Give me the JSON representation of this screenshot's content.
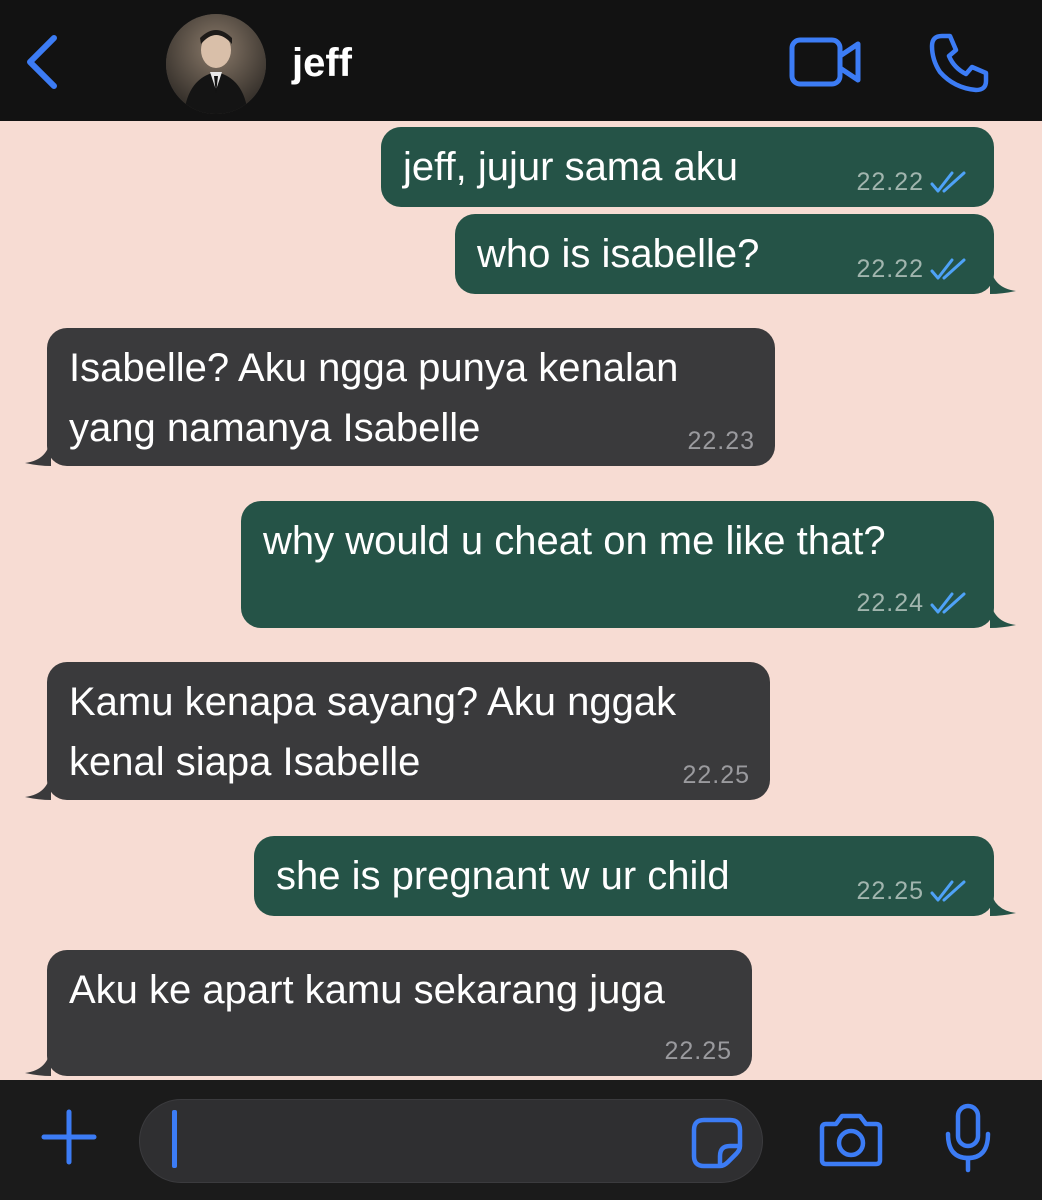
{
  "header": {
    "contact_name": "jeff",
    "icons": [
      "back-chevron-icon",
      "avatar",
      "video-call-icon",
      "phone-call-icon"
    ]
  },
  "messages": [
    {
      "direction": "out",
      "text": "jeff, jujur sama aku",
      "time": "22.22",
      "status": "read"
    },
    {
      "direction": "out",
      "text": "who is isabelle?",
      "time": "22.22",
      "status": "read"
    },
    {
      "direction": "in",
      "text": "Isabelle? Aku ngga punya kenalan yang namanya Isabelle",
      "time": "22.23"
    },
    {
      "direction": "out",
      "text": "why would u cheat on me like that?",
      "time": "22.24",
      "status": "read"
    },
    {
      "direction": "in",
      "text": "Kamu kenapa sayang? Aku nggak kenal siapa Isabelle",
      "time": "22.25"
    },
    {
      "direction": "out",
      "text": "she is pregnant w ur child",
      "time": "22.25",
      "status": "read"
    },
    {
      "direction": "in",
      "text": "Aku ke apart kamu sekarang juga",
      "time": "22.25"
    }
  ],
  "composer": {
    "value": "",
    "icons": [
      "plus-icon",
      "sticker-icon",
      "camera-icon",
      "microphone-icon"
    ]
  },
  "colors": {
    "background": "#f7dcd3",
    "outgoing_bubble": "#255347",
    "incoming_bubble": "#3a3a3c",
    "accent_blue": "#3c7cf5",
    "bar": "#121212"
  }
}
